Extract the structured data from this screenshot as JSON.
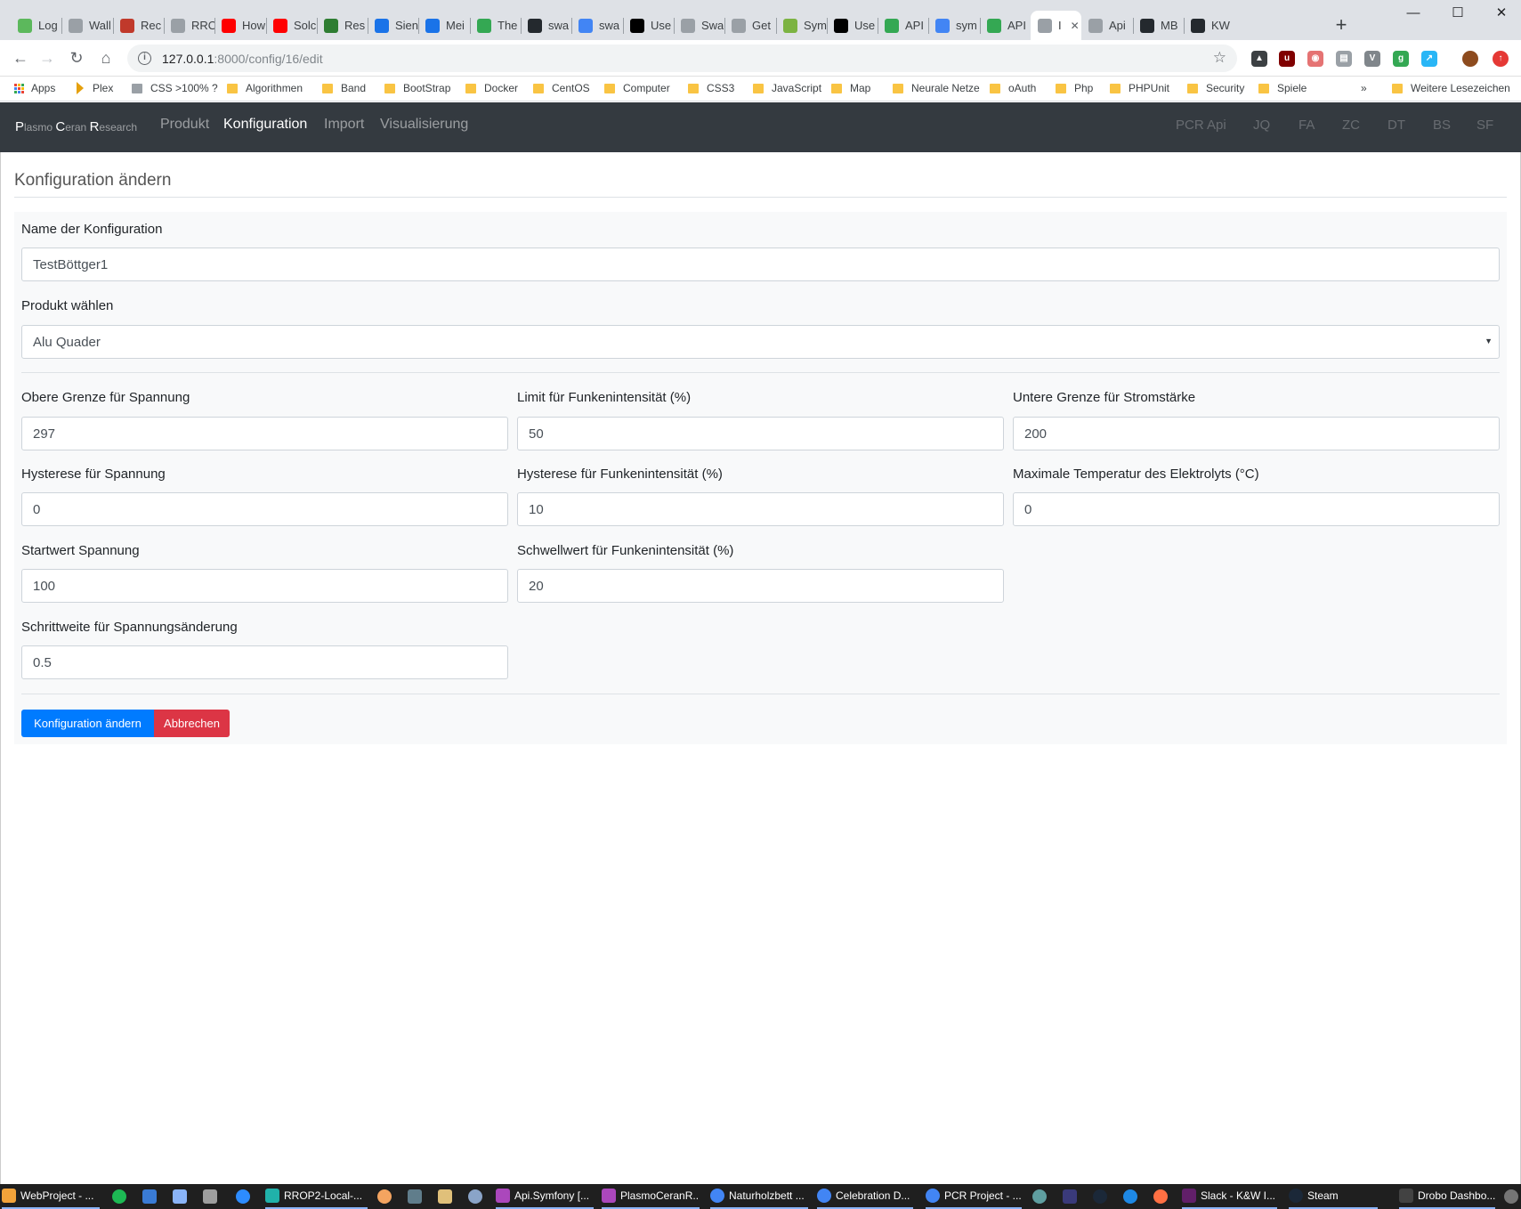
{
  "browser": {
    "tabs": [
      {
        "label": "Log",
        "color": "#5cb85c"
      },
      {
        "label": "Wall",
        "color": "#9aa0a6"
      },
      {
        "label": "Rec",
        "color": "#c0392b"
      },
      {
        "label": "RRO",
        "color": "#9aa0a6"
      },
      {
        "label": "How",
        "color": "#ff0000"
      },
      {
        "label": "Solc",
        "color": "#ff0000"
      },
      {
        "label": "Res",
        "color": "#2e7d32"
      },
      {
        "label": "Sien",
        "color": "#1a73e8"
      },
      {
        "label": "Mei",
        "color": "#1a73e8"
      },
      {
        "label": "The",
        "color": "#34a853"
      },
      {
        "label": "swa",
        "color": "#24292e"
      },
      {
        "label": "swa",
        "color": "#4285f4"
      },
      {
        "label": "Use",
        "color": "#000000"
      },
      {
        "label": "Swa",
        "color": "#9aa0a6"
      },
      {
        "label": "Get",
        "color": "#9aa0a6"
      },
      {
        "label": "Sym",
        "color": "#7cb342"
      },
      {
        "label": "Use",
        "color": "#000000"
      },
      {
        "label": "API",
        "color": "#34a853"
      },
      {
        "label": "sym",
        "color": "#4285f4"
      },
      {
        "label": "API",
        "color": "#34a853"
      },
      {
        "label": "I",
        "color": "#9aa0a6",
        "active": true
      },
      {
        "label": "Api",
        "color": "#9aa0a6"
      },
      {
        "label": "MB",
        "color": "#24292e"
      },
      {
        "label": "KW",
        "color": "#24292e"
      }
    ],
    "new_tab": "+",
    "window_controls": {
      "minimize": "—",
      "maximize": "☐",
      "close": "✕"
    },
    "url_host": "127.0.0.1",
    "url_path": ":8000/config/16/edit",
    "bookmarks": [
      "Apps",
      "Plex",
      "CSS >100% ?",
      "Algorithmen",
      "Band",
      "BootStrap",
      "Docker",
      "CentOS",
      "Computer",
      "CSS3",
      "JavaScript",
      "Map",
      "Neurale Netze",
      "oAuth",
      "Php",
      "PHPUnit",
      "Security",
      "Spiele"
    ],
    "bookmarks_overflow": "»",
    "other_bookmarks": "Weitere Lesezeichen"
  },
  "app": {
    "brand": {
      "p": "P",
      "lasmo": "lasmo ",
      "c": "C",
      "eran": "eran ",
      "r": "R",
      "esearch": "esearch"
    },
    "nav": [
      "Produkt",
      "Konfiguration",
      "Import",
      "Visualisierung"
    ],
    "nav_active": "Konfiguration",
    "nav_right": [
      "PCR Api",
      "JQ",
      "FA",
      "ZC",
      "DT",
      "BS",
      "SF"
    ]
  },
  "form": {
    "title": "Konfiguration ändern",
    "name_label": "Name der Konfiguration",
    "name_value": "TestBöttger1",
    "product_label": "Produkt wählen",
    "product_value": "Alu Quader",
    "fields": {
      "obere_grenze_spannung": {
        "label": "Obere Grenze für Spannung",
        "value": "297"
      },
      "limit_funkenintensitaet": {
        "label": "Limit für Funkenintensität (%)",
        "value": "50"
      },
      "untere_grenze_stromstaerke": {
        "label": "Untere Grenze für Stromstärke",
        "value": "200"
      },
      "hysterese_spannung": {
        "label": "Hysterese für Spannung",
        "value": "0"
      },
      "hysterese_funkenintensitaet": {
        "label": "Hysterese für Funkenintensität (%)",
        "value": "10"
      },
      "max_temperatur": {
        "label": "Maximale Temperatur des Elektrolyts (°C)",
        "value": "0"
      },
      "startwert_spannung": {
        "label": "Startwert Spannung",
        "value": "100"
      },
      "schwellwert_funkenintensitaet": {
        "label": "Schwellwert für Funkenintensität (%)",
        "value": "20"
      },
      "schrittweite_spannung": {
        "label": "Schrittweite für Spannungsänderung",
        "value": "0.5"
      }
    },
    "submit_label": "Konfiguration ändern",
    "cancel_label": "Abbrechen"
  },
  "taskbar": {
    "items": [
      "WebProject - ...",
      "RROP2-Local-...",
      "Api.Symfony [...",
      "PlasmoCeranR...",
      "Naturholzbett ...",
      "Celebration D...",
      "PCR Project - ...",
      "Slack - K&W I...",
      "Steam",
      "Drobo Dashbo..."
    ]
  }
}
